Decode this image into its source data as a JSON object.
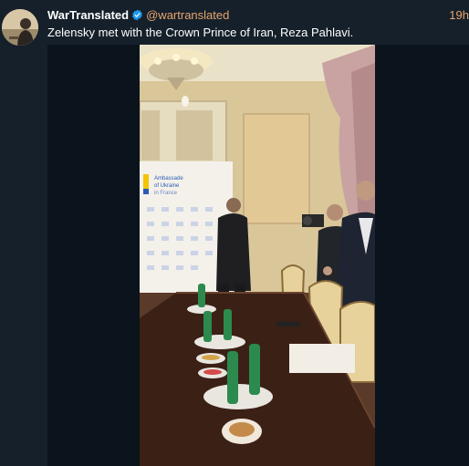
{
  "tweet": {
    "display_name": "WarTranslated",
    "handle": "@wartranslated",
    "time": "19h",
    "text": "Zelensky met with the Crown Prince of Iran, Reza Pahlavi.",
    "verified": true
  },
  "video": {
    "banner_text_line1": "Ambassade",
    "banner_text_line2": "of Ukraine",
    "banner_text_line3": "in France"
  },
  "colors": {
    "background": "#15202b",
    "accent": "#e7a56b",
    "verified": "#1d9bf0"
  },
  "icons": {
    "verified": "verified-badge-icon"
  }
}
